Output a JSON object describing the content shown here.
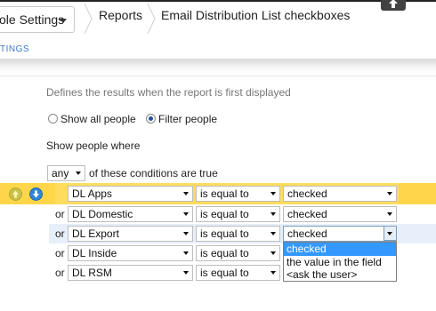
{
  "header": {
    "settings_button": "ole Settings",
    "breadcrumbs": [
      "Reports",
      "Email Distribution List checkboxes"
    ],
    "sub_tab": "TINGS"
  },
  "filter": {
    "description": "Defines the results when the report is first displayed",
    "radio_all": "Show all people",
    "radio_filter": "Filter people",
    "selected_radio": "Filter people",
    "show_where": "Show people where",
    "match_select": "any",
    "match_suffix": "of these conditions are true"
  },
  "conditions": [
    {
      "prefix": "",
      "field": "DL Apps",
      "operator": "is equal to",
      "value": "checked"
    },
    {
      "prefix": "or",
      "field": "DL Domestic",
      "operator": "is equal to",
      "value": "checked"
    },
    {
      "prefix": "or",
      "field": "DL Export",
      "operator": "is equal to",
      "value": "checked"
    },
    {
      "prefix": "or",
      "field": "DL Inside",
      "operator": "is equal to",
      "value": ""
    },
    {
      "prefix": "or",
      "field": "DL RSM",
      "operator": "is equal to",
      "value": ""
    }
  ],
  "dropdown_options": [
    "checked",
    "the value in the field",
    "<ask the user>"
  ],
  "dropdown_selected": "checked",
  "colors": {
    "highlight_row": "#ffd64a",
    "hover_row": "#e6effa",
    "selection": "#3399ff",
    "link": "#3a7ac3"
  },
  "icons": {
    "row_up": "circle-arrow-up-icon",
    "row_down": "circle-arrow-down-icon",
    "upload": "upload-arrow-icon"
  }
}
